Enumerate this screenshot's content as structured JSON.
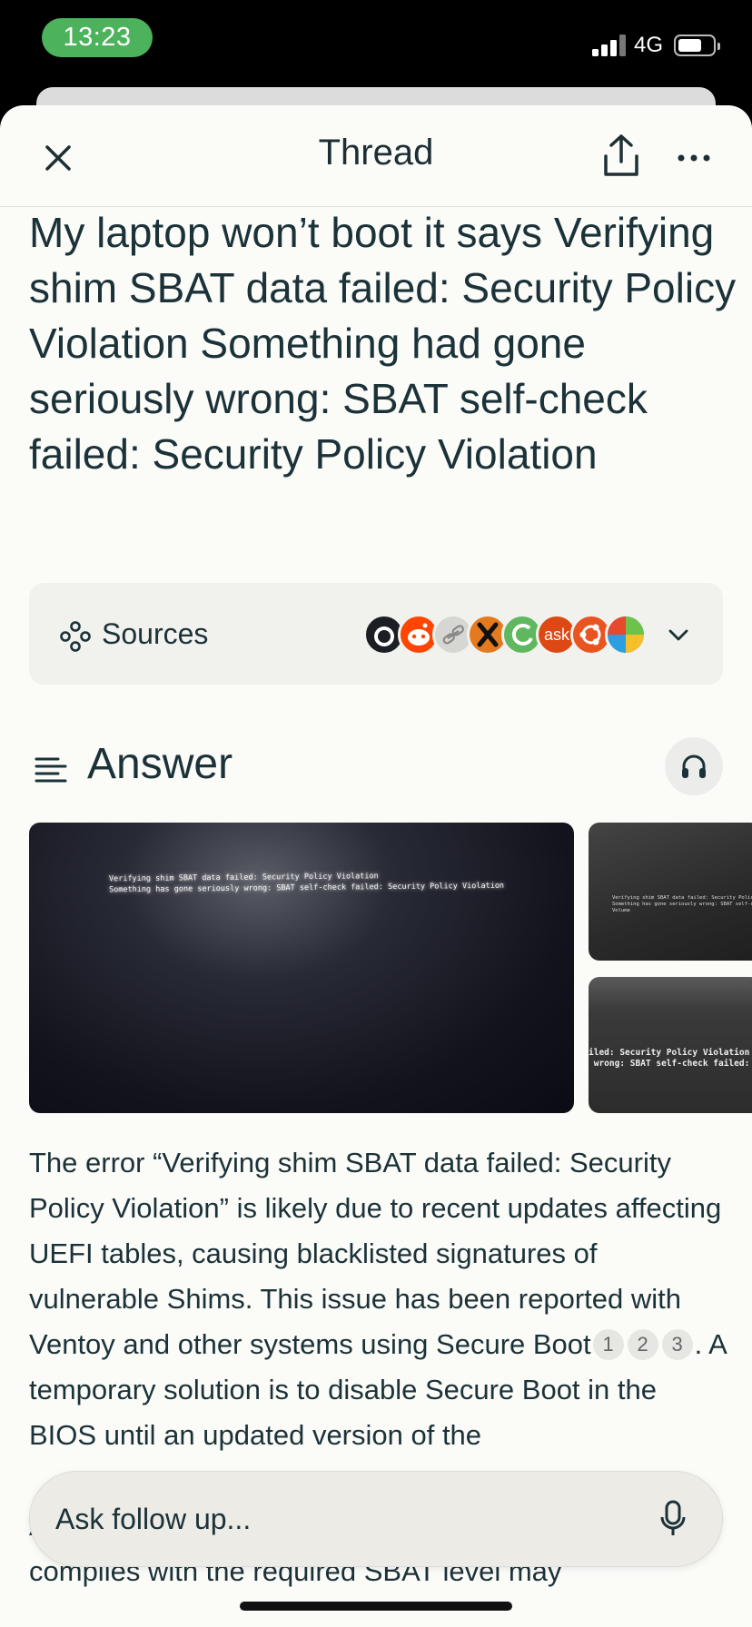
{
  "status_bar": {
    "time": "13:23",
    "network": "4G"
  },
  "nav": {
    "title": "Thread",
    "close_icon": "close-icon",
    "share_icon": "share-icon",
    "more_icon": "more-icon"
  },
  "question": "My laptop won’t boot it says Verifying shim SBAT data failed: Security Policy Violation Something had gone seriously wrong: SBAT self-check failed: Security Policy Violation",
  "sources": {
    "label": "Sources",
    "favicons": [
      {
        "name": "github-icon",
        "color": "#1b1f23",
        "glyph": ""
      },
      {
        "name": "reddit-icon",
        "color": "#ff4500",
        "glyph": ""
      },
      {
        "name": "link-icon",
        "color": "#d6d6d2",
        "glyph": ""
      },
      {
        "name": "x-icon",
        "color": "#e47a1f",
        "glyph": ""
      },
      {
        "name": "site-icon-green",
        "color": "#5fb85f",
        "glyph": ""
      },
      {
        "name": "askubuntu-icon",
        "color": "#dd4814",
        "glyph": "ask"
      },
      {
        "name": "ubuntu-icon",
        "color": "#e95420",
        "glyph": ""
      },
      {
        "name": "windows-icon",
        "color": "#38a3de",
        "glyph": ""
      }
    ]
  },
  "answer": {
    "label": "Answer",
    "text_part1": "The error “Verifying shim SBAT data failed: Security Policy Violation” is likely due to recent updates affecting UEFI tables, causing blacklisted signatures of vulnerable Shims. This issue has been reported with Ventoy and other systems using Secure Boot",
    "citations": [
      "1",
      "2",
      "3"
    ],
    "text_part2": ". A temporary solution is to disable Secure Boot in the BIOS until an updated version of the",
    "text_part3": "Alternatively, updating the Shim to a version that complies with the required SBAT level may"
  },
  "images": {
    "main_text": "Verifying shim SBAT data failed: Security Policy Violation\nSomething has gone seriously wrong: SBAT self-check failed: Security Policy Violation",
    "side1_text": "Verifying shim SBAT data failed: Security Policy Violation\nSomething has gone seriously wrong: SBAT self-check failed\nVolume",
    "side2_text": "iled: Security Policy Violation\n wrong: SBAT self-check failed: S"
  },
  "ask": {
    "placeholder": "Ask follow up..."
  },
  "colors": {
    "time_pill": "#4cb35c",
    "sheet_bg": "#fbfbf8",
    "text": "#1b3238"
  }
}
